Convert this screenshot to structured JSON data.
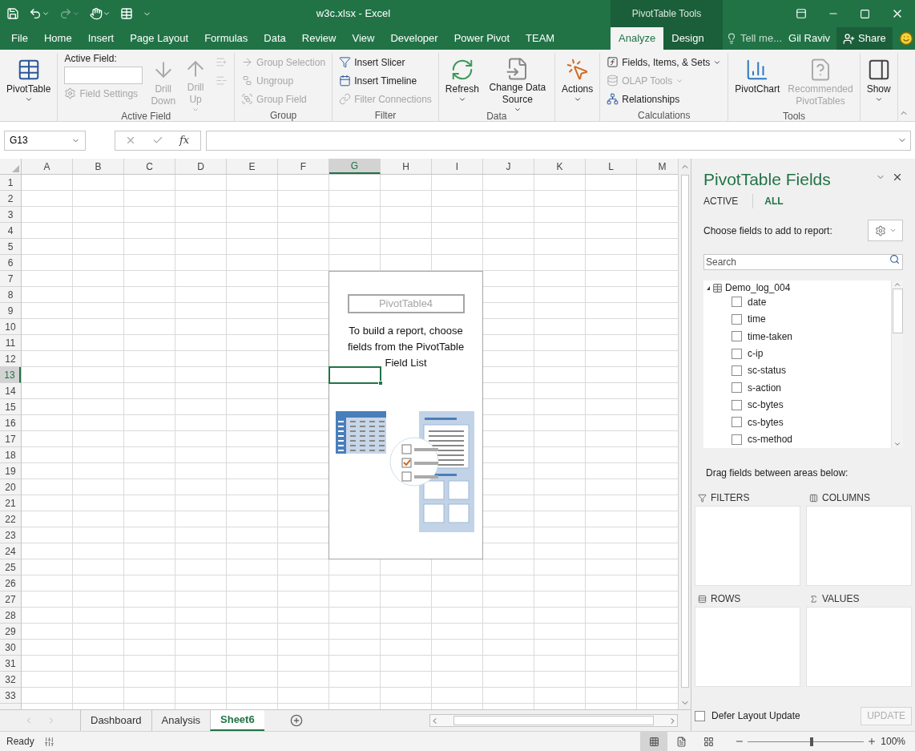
{
  "window": {
    "title": "w3c.xlsx - Excel",
    "context_group": "PivotTable Tools"
  },
  "tabs": [
    {
      "label": "File",
      "kind": "main",
      "selected": false
    },
    {
      "label": "Home",
      "kind": "main",
      "selected": false
    },
    {
      "label": "Insert",
      "kind": "main",
      "selected": false
    },
    {
      "label": "Page Layout",
      "kind": "main",
      "selected": false
    },
    {
      "label": "Formulas",
      "kind": "main",
      "selected": false
    },
    {
      "label": "Data",
      "kind": "main",
      "selected": false
    },
    {
      "label": "Review",
      "kind": "main",
      "selected": false
    },
    {
      "label": "View",
      "kind": "main",
      "selected": false
    },
    {
      "label": "Developer",
      "kind": "main",
      "selected": false
    },
    {
      "label": "Power Pivot",
      "kind": "main",
      "selected": false
    },
    {
      "label": "TEAM",
      "kind": "main",
      "selected": false
    },
    {
      "label": "Analyze",
      "kind": "context",
      "selected": true
    },
    {
      "label": "Design",
      "kind": "context",
      "selected": false
    }
  ],
  "tell_me": "Tell me...",
  "user": "Gil Raviv",
  "share": "Share",
  "ribbon_groups": [
    {
      "columns": [
        [
          {
            "kind": "large",
            "label": "PivotTable",
            "dropdown": true,
            "disabled": false
          }
        ]
      ]
    },
    {
      "label": "Active Field",
      "columns": [
        [
          {
            "kind": "field",
            "label": "Active Field:"
          },
          {
            "kind": "small",
            "label": "Field Settings",
            "dropdown": false,
            "disabled": true
          }
        ],
        [
          {
            "kind": "large",
            "label": "Drill Down",
            "dropdown": false,
            "disabled": true
          }
        ],
        [
          {
            "kind": "large",
            "label": "Drill Up",
            "dropdown": true,
            "disabled": true
          }
        ],
        [
          {
            "kind": "icon",
            "disabled": true
          },
          {
            "kind": "icon",
            "disabled": true
          }
        ]
      ]
    },
    {
      "label": "Group",
      "columns": [
        [
          {
            "kind": "small",
            "label": "Group Selection",
            "dropdown": false,
            "disabled": true
          },
          {
            "kind": "small",
            "label": "Ungroup",
            "dropdown": false,
            "disabled": true
          },
          {
            "kind": "small",
            "label": "Group Field",
            "dropdown": false,
            "disabled": true
          }
        ]
      ]
    },
    {
      "label": "Filter",
      "columns": [
        [
          {
            "kind": "small",
            "label": "Insert Slicer",
            "dropdown": false,
            "disabled": false
          },
          {
            "kind": "small",
            "label": "Insert Timeline",
            "dropdown": false,
            "disabled": false
          },
          {
            "kind": "small",
            "label": "Filter Connections",
            "dropdown": false,
            "disabled": true
          }
        ]
      ]
    },
    {
      "label": "Data",
      "columns": [
        [
          {
            "kind": "large",
            "label": "Refresh",
            "dropdown": true,
            "disabled": false
          }
        ],
        [
          {
            "kind": "large",
            "label": "Change Data Source",
            "dropdown": true,
            "disabled": false
          }
        ]
      ]
    },
    {
      "columns": [
        [
          {
            "kind": "large",
            "label": "Actions",
            "dropdown": true,
            "disabled": false
          }
        ]
      ]
    },
    {
      "label": "Calculations",
      "columns": [
        [
          {
            "kind": "small",
            "label": "Fields, Items, & Sets",
            "dropdown": true,
            "disabled": false
          },
          {
            "kind": "small",
            "label": "OLAP Tools",
            "dropdown": true,
            "disabled": true
          },
          {
            "kind": "small",
            "label": "Relationships",
            "dropdown": false,
            "disabled": false
          }
        ]
      ]
    },
    {
      "label": "Tools",
      "columns": [
        [
          {
            "kind": "large",
            "label": "PivotChart",
            "dropdown": false,
            "disabled": false
          }
        ],
        [
          {
            "kind": "large",
            "label": "Recommended PivotTables",
            "dropdown": false,
            "disabled": true
          }
        ]
      ]
    },
    {
      "columns": [
        [
          {
            "kind": "large",
            "label": "Show",
            "dropdown": true,
            "disabled": false
          }
        ]
      ]
    }
  ],
  "formula_bar": {
    "name_box": "G13",
    "function_button": "fx"
  },
  "grid": {
    "columns": [
      {
        "label": "A",
        "selected": false
      },
      {
        "label": "B",
        "selected": false
      },
      {
        "label": "C",
        "selected": false
      },
      {
        "label": "D",
        "selected": false
      },
      {
        "label": "E",
        "selected": false
      },
      {
        "label": "F",
        "selected": false
      },
      {
        "label": "G",
        "selected": true
      },
      {
        "label": "H",
        "selected": false
      },
      {
        "label": "I",
        "selected": false
      },
      {
        "label": "J",
        "selected": false
      },
      {
        "label": "K",
        "selected": false
      },
      {
        "label": "L",
        "selected": false
      },
      {
        "label": "M",
        "selected": false
      }
    ],
    "rows": [
      {
        "label": "1",
        "selected": false
      },
      {
        "label": "2",
        "selected": false
      },
      {
        "label": "3",
        "selected": false
      },
      {
        "label": "4",
        "selected": false
      },
      {
        "label": "5",
        "selected": false
      },
      {
        "label": "6",
        "selected": false
      },
      {
        "label": "7",
        "selected": false
      },
      {
        "label": "8",
        "selected": false
      },
      {
        "label": "9",
        "selected": false
      },
      {
        "label": "10",
        "selected": false
      },
      {
        "label": "11",
        "selected": false
      },
      {
        "label": "12",
        "selected": false
      },
      {
        "label": "13",
        "selected": true
      },
      {
        "label": "14",
        "selected": false
      },
      {
        "label": "15",
        "selected": false
      },
      {
        "label": "16",
        "selected": false
      },
      {
        "label": "17",
        "selected": false
      },
      {
        "label": "18",
        "selected": false
      },
      {
        "label": "19",
        "selected": false
      },
      {
        "label": "20",
        "selected": false
      },
      {
        "label": "21",
        "selected": false
      },
      {
        "label": "22",
        "selected": false
      },
      {
        "label": "23",
        "selected": false
      },
      {
        "label": "24",
        "selected": false
      },
      {
        "label": "25",
        "selected": false
      },
      {
        "label": "26",
        "selected": false
      },
      {
        "label": "27",
        "selected": false
      },
      {
        "label": "28",
        "selected": false
      },
      {
        "label": "29",
        "selected": false
      },
      {
        "label": "30",
        "selected": false
      },
      {
        "label": "31",
        "selected": false
      },
      {
        "label": "32",
        "selected": false
      },
      {
        "label": "33",
        "selected": false
      }
    ]
  },
  "pivot_placeholder": {
    "name": "PivotTable4",
    "message": "To build a report, choose fields from the PivotTable Field List"
  },
  "sheet_tabs": [
    {
      "label": "Dashboard",
      "selected": false
    },
    {
      "label": "Analysis",
      "selected": false
    },
    {
      "label": "Sheet6",
      "selected": true
    }
  ],
  "field_pane": {
    "title": "PivotTable Fields",
    "tabs": [
      {
        "label": "ACTIVE",
        "selected": false
      },
      {
        "label": "ALL",
        "selected": true
      }
    ],
    "choose_label": "Choose fields to add to report:",
    "search": {
      "placeholder": "Search"
    },
    "table": {
      "name": "Demo_log_004",
      "expanded": true,
      "fields": [
        {
          "label": "date",
          "checked": false
        },
        {
          "label": "time",
          "checked": false
        },
        {
          "label": "time-taken",
          "checked": false
        },
        {
          "label": "c-ip",
          "checked": false
        },
        {
          "label": "sc-status",
          "checked": false
        },
        {
          "label": "s-action",
          "checked": false
        },
        {
          "label": "sc-bytes",
          "checked": false
        },
        {
          "label": "cs-bytes",
          "checked": false
        },
        {
          "label": "cs-method",
          "checked": false
        }
      ]
    },
    "areas_hint": "Drag fields between areas below:",
    "areas": [
      {
        "kind": "filters",
        "label": "FILTERS"
      },
      {
        "kind": "columns",
        "label": "COLUMNS"
      },
      {
        "kind": "rows",
        "label": "ROWS"
      },
      {
        "kind": "values",
        "label": "VALUES"
      }
    ],
    "defer_update": {
      "label": "Defer Layout Update",
      "checked": false
    },
    "update_button": {
      "label": "UPDATE",
      "disabled": true
    }
  },
  "status_bar": {
    "status": "Ready",
    "views": [
      {
        "kind": "normal",
        "selected": true
      },
      {
        "kind": "page_layout",
        "selected": false
      },
      {
        "kind": "page_break",
        "selected": false
      }
    ],
    "zoom": {
      "level": 0.55,
      "reading": "100%"
    }
  }
}
